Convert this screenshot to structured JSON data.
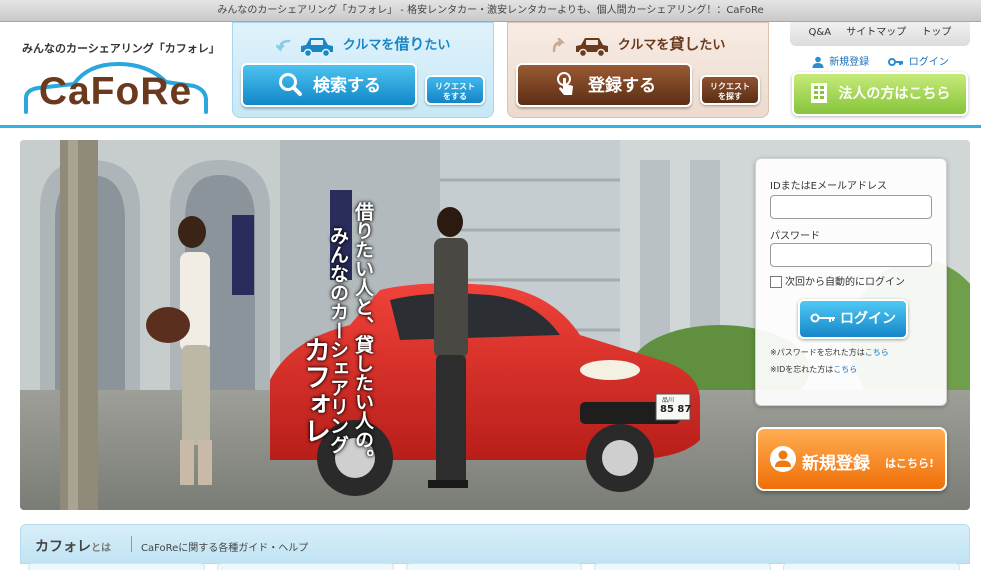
{
  "window": {
    "title": "みんなのカーシェアリング「カフォレ」 - 格安レンタカー・激安レンタカーよりも、個人間カーシェアリング！：CaFoRe"
  },
  "header": {
    "tagline": "みんなのカーシェアリング「カフォレ」",
    "logo_text": "CaFoRe",
    "utility_nav": [
      "Q&A",
      "サイトマップ",
      "トップ"
    ],
    "signup_link": "新規登録",
    "login_link": "ログイン",
    "corporate_button": "法人の方はこちら"
  },
  "rent_panel": {
    "heading_prefix": "クルマを",
    "heading_emphasis": "借り",
    "heading_suffix": "たい",
    "search_button": "検索する",
    "request_button_line1": "リクエスト",
    "request_button_line2": "をする"
  },
  "lend_panel": {
    "heading_prefix": "クルマを",
    "heading_emphasis": "貸し",
    "heading_suffix": "たい",
    "register_button": "登録する",
    "request_button_line1": "リクエスト",
    "request_button_line2": "を探す"
  },
  "hero": {
    "catch_line1": "借りたい人と、貸したい人の。",
    "catch_line2": "みんなのカーシェアリング",
    "catch_line3": "カフォレ",
    "plate_top": "品川",
    "plate_number": "85 87"
  },
  "login": {
    "id_label": "IDまたはEメールアドレス",
    "id_value": "",
    "password_label": "パスワード",
    "password_value": "",
    "remember_label": "次回から自動的にログイン",
    "login_button": "ログイン",
    "forgot_password_text": "※パスワードを忘れた方は",
    "forgot_id_text": "※IDを忘れた方は",
    "here_link": "こちら"
  },
  "signup": {
    "main_text": "新規登録",
    "suffix_text": "はこちら!"
  },
  "guide": {
    "title_main": "カフォレ",
    "title_small": "とは",
    "subtitle": "CaFoReに関する各種ガイド・ヘルプ"
  },
  "colors": {
    "accent_blue": "#32b2e0",
    "brand_brown": "#6b3a1e",
    "signup_orange": "#ef6f08",
    "corporate_green": "#86c43a"
  }
}
